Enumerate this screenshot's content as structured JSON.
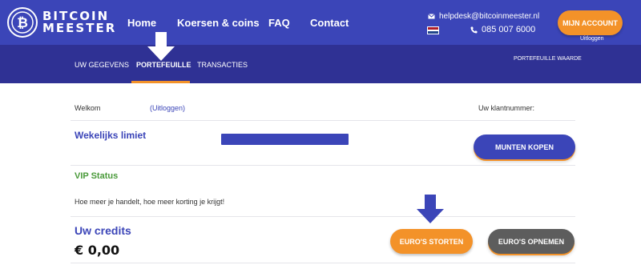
{
  "brand": {
    "line1": "BITCOIN",
    "line2": "MEESTER"
  },
  "main_nav": {
    "home": "Home",
    "koersen": "Koersen & coins",
    "faq": "FAQ",
    "contact": "Contact"
  },
  "contact": {
    "email": "helpdesk@bitcoinmeester.nl",
    "phone": "085 007 6000"
  },
  "account": {
    "button": "MIJN ACCOUNT",
    "logout": "Uitloggen"
  },
  "sub_nav": {
    "gegevens": "UW GEGEVENS",
    "portefeuille": "PORTEFEUILLE",
    "transacties": "TRANSACTIES",
    "waarde": "PORTEFEUILLE WAARDE",
    "active": "PORTEFEUILLE"
  },
  "welcome": {
    "label": "Welkom",
    "logout_link": "(Uitloggen)",
    "klant_label": "Uw klantnummer:"
  },
  "limiet": {
    "title": "Wekelijks limiet",
    "button": "MUNTEN KOPEN"
  },
  "vip": {
    "title": "VIP Status",
    "text": "Hoe meer je handelt, hoe meer korting je krijgt!"
  },
  "credits": {
    "title": "Uw credits",
    "value": "€ 0,00",
    "deposit_button": "EURO'S STORTEN",
    "withdraw_button": "EURO'S OPNEMEN"
  },
  "colors": {
    "primary": "#3b45b8",
    "subnav": "#2f3194",
    "accent": "#f39229",
    "vip": "#4a9a3a",
    "grey_button": "#5d5d5d"
  },
  "icons": {
    "logo": "bitcoin-logo-icon",
    "email": "envelope-icon",
    "phone": "phone-icon",
    "flag": "flag-nl-icon",
    "arrows": "arrow-down-icon"
  }
}
